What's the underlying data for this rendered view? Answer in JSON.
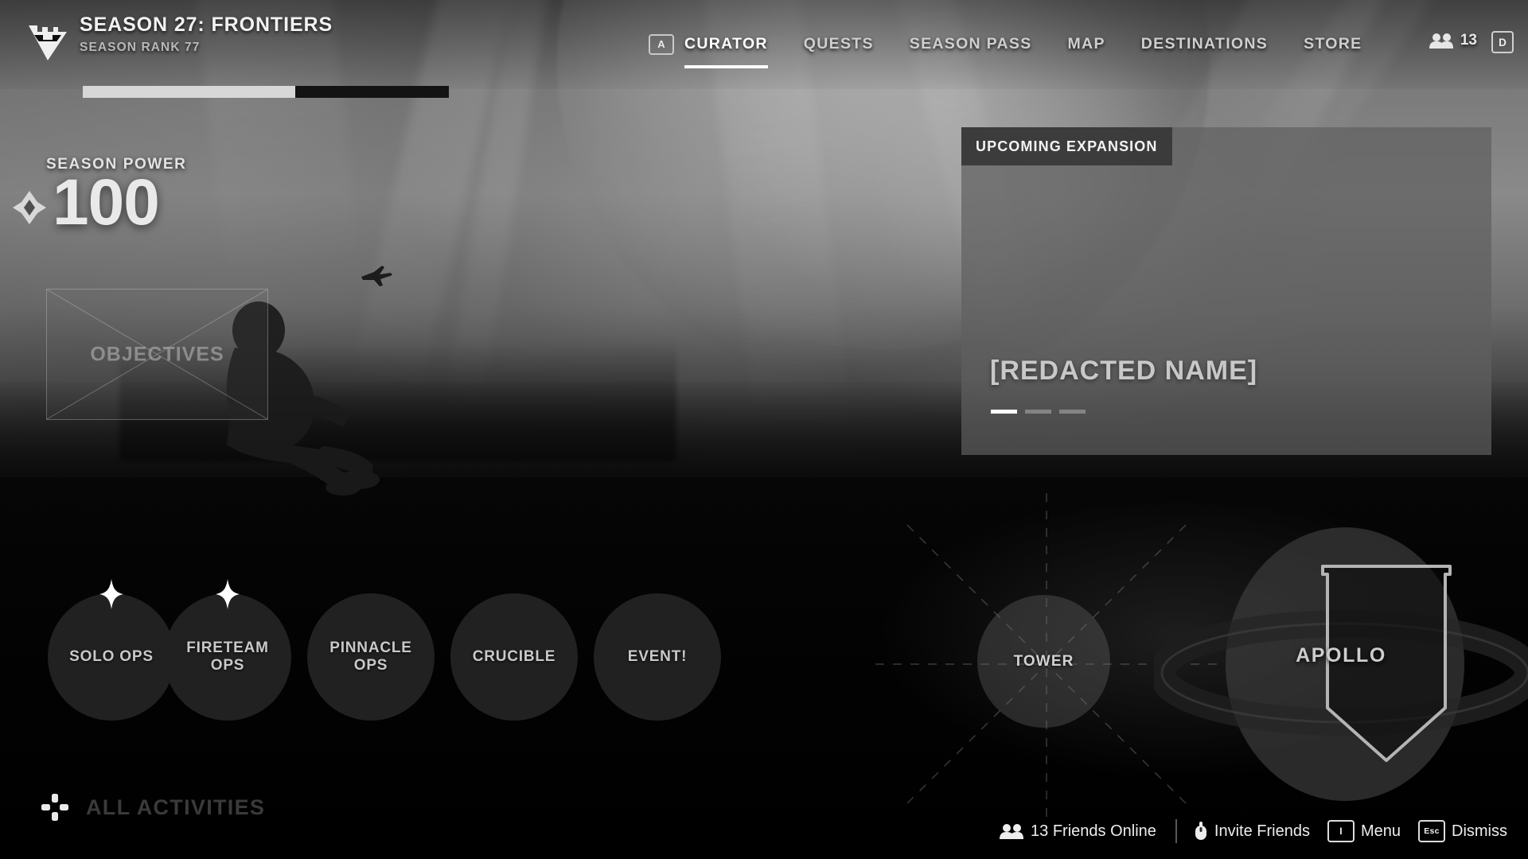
{
  "header": {
    "season_title": "SEASON 27: FRONTIERS",
    "season_rank": "SEASON RANK 77",
    "season_progress_percent": 58,
    "crest_icon": "vanguard-crest-icon"
  },
  "nav": {
    "key_hint": "A",
    "items": [
      {
        "label": "CURATOR",
        "active": true
      },
      {
        "label": "QUESTS",
        "active": false
      },
      {
        "label": "SEASON PASS",
        "active": false
      },
      {
        "label": "MAP",
        "active": false
      },
      {
        "label": "DESTINATIONS",
        "active": false
      },
      {
        "label": "STORE",
        "active": false
      }
    ],
    "friends_count": "13",
    "profile_key": "D"
  },
  "power": {
    "label": "SEASON POWER",
    "value": "100",
    "icon": "power-diamond-icon"
  },
  "objectives": {
    "label": "OBJECTIVES"
  },
  "expansion": {
    "badge": "UPCOMING EXPANSION",
    "name": "[REDACTED NAME]",
    "dots": 3,
    "active_dot": 0
  },
  "activities": {
    "nodes": [
      {
        "label": "SOLO OPS",
        "spark": true
      },
      {
        "label": "FIRETEAM OPS",
        "spark": true
      },
      {
        "label": "PINNACLE OPS",
        "spark": false
      },
      {
        "label": "CRUCIBLE",
        "spark": false
      },
      {
        "label": "EVENT!",
        "spark": false
      }
    ],
    "tower": "TOWER",
    "apollo": "APOLLO",
    "all_activities": "ALL ACTIVITIES",
    "dpad_icon": "dpad-icon"
  },
  "footer": {
    "friends_online": "13 Friends Online",
    "invite_friends": "Invite Friends",
    "menu": "Menu",
    "menu_key": "I",
    "dismiss": "Dismiss",
    "dismiss_key": "Esc",
    "friends_icon": "people-icon",
    "mouse_icon": "mouse-icon"
  },
  "colors": {
    "accent": "#ffffff",
    "panel": "#606060",
    "node": "#212121"
  }
}
